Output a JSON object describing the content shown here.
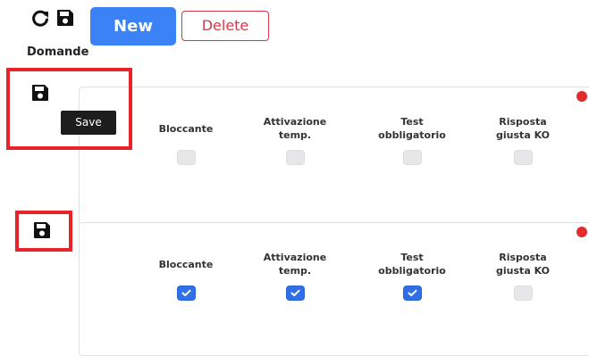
{
  "toolbar": {
    "refresh_icon": "refresh-icon",
    "save_icon": "floppy-disk-icon",
    "new_label": "New",
    "delete_label": "Delete"
  },
  "section": {
    "title": "Domande"
  },
  "tooltip": {
    "text": "Save"
  },
  "columns": [
    {
      "label_line1": "Bloccante",
      "label_line2": ""
    },
    {
      "label_line1": "Attivazione",
      "label_line2": "temp."
    },
    {
      "label_line1": "Test",
      "label_line2": "obbligatorio"
    },
    {
      "label_line1": "Risposta",
      "label_line2": "giusta KO"
    }
  ],
  "rows": [
    {
      "checked": [
        false,
        false,
        false,
        false
      ]
    },
    {
      "checked": [
        true,
        true,
        true,
        false
      ]
    }
  ],
  "colors": {
    "primary": "#3b82f6",
    "danger": "#dc3545",
    "annotation": "#e8242a",
    "status_dot": "#e32b2b",
    "checkbox_on": "#2f6fe7"
  }
}
